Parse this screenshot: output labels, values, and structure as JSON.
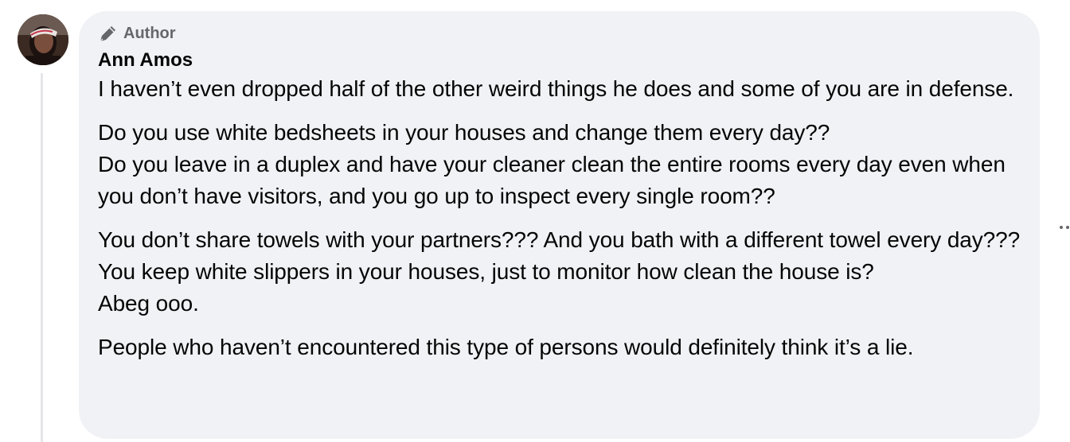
{
  "comment": {
    "badge_label": "Author",
    "author_name": "Ann Amos",
    "paragraphs": [
      "I haven’t even dropped half of the other weird things he does and some of you are in defense.",
      "Do you use white bedsheets in your houses and change them every day??\nDo you leave in a duplex and have your cleaner clean the entire rooms every day even when you don’t have visitors, and you go up to inspect every single room??",
      "You don’t share towels with your partners??? And you bath with a different towel every day???\nYou keep white slippers in your houses, just to monitor how clean the house is?\nAbeg ooo.",
      "People who haven’t encountered this type of persons would definitely think it’s a lie."
    ]
  },
  "icons": {
    "badge": "pen-icon",
    "options": "more-options-icon"
  },
  "colors": {
    "bubble_bg": "#f0f2f5",
    "badge_text": "#65676b",
    "text": "#050505",
    "thread_line": "#e4e6eb"
  }
}
